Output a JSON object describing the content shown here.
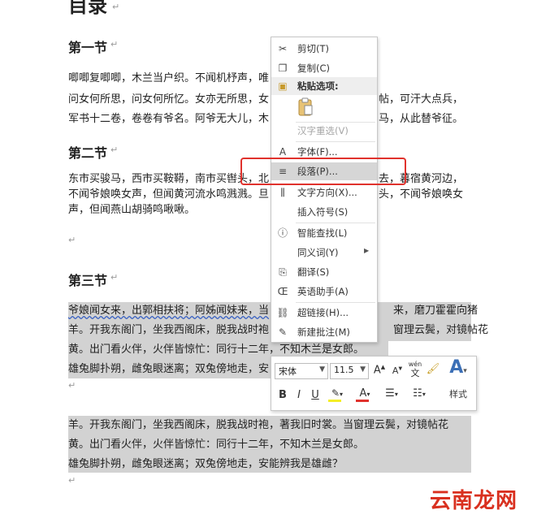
{
  "doc": {
    "title": "目录",
    "sections": [
      {
        "heading": "第一节",
        "lines": [
          "唧唧复唧唧，木兰当户织。不闻机杼声，唯",
          "问女何所思，问女何所忆。女亦无所思，女",
          "军书十二卷，卷卷有爷名。阿爷无大儿，木"
        ],
        "right": [
          "帖，可汗大点兵，",
          "马，从此替爷征。"
        ]
      },
      {
        "heading": "第二节",
        "lines": [
          "东市买骏马，西市买鞍鞯，南市买辔头，北",
          "不闻爷娘唤女声，但闻黄河流水鸣溅溅。旦",
          "声，但闻燕山胡骑鸣啾啾。"
        ],
        "right": [
          "去，暮宿黄河边，",
          "头，不闻爷娘唤女"
        ]
      },
      {
        "heading": "第三节",
        "lines": [
          "爷娘闻女来，出郭相扶将；阿姊闻妹来，当",
          "羊。开我东阁门，坐我西阁床，脱我战时袍",
          "黄。出门看火伴，火伴皆惊忙：同行十二年，不知木兰是女郎。",
          "雄兔脚扑朔，雌兔眼迷离；双兔傍地走，安"
        ],
        "right": [
          "来，磨刀霍霍向猪",
          "窗理云鬓，对镜帖花"
        ]
      },
      {
        "heading": "",
        "lines": [
          "羊。开我东阁门，坐我西阁床，脱我战时袍，著我旧时裳。当窗理云鬓，对镜帖花",
          "黄。出门看火伴，火伴皆惊忙：同行十二年，不知木兰是女郎。",
          "雄兔脚扑朔，雌兔眼迷离；双兔傍地走，安能辨我是雄雌？"
        ],
        "right": []
      }
    ]
  },
  "context_menu": {
    "items": [
      {
        "label": "剪切(T)",
        "icon": "scissors-icon",
        "glyph": "✂",
        "disabled": false
      },
      {
        "label": "复制(C)",
        "icon": "copy-icon",
        "glyph": "❐",
        "disabled": false
      },
      {
        "label": "粘贴选项:",
        "icon": "paste-icon",
        "glyph": "📋",
        "disabled": false
      },
      {
        "label": "汉字重选(V)",
        "icon": "",
        "glyph": "",
        "disabled": true
      },
      {
        "label": "字体(F)...",
        "icon": "font-icon",
        "glyph": "A",
        "disabled": false
      },
      {
        "label": "段落(P)...",
        "icon": "paragraph-icon",
        "glyph": "≡",
        "disabled": false
      },
      {
        "label": "文字方向(X)...",
        "icon": "text-direction-icon",
        "glyph": "⫼",
        "disabled": false
      },
      {
        "label": "插入符号(S)",
        "icon": "",
        "glyph": "",
        "disabled": false
      },
      {
        "label": "智能查找(L)",
        "icon": "smart-lookup-icon",
        "glyph": "ⓘ",
        "disabled": false
      },
      {
        "label": "同义词(Y)",
        "icon": "",
        "glyph": "",
        "disabled": false
      },
      {
        "label": "翻译(S)",
        "icon": "translate-icon",
        "glyph": "⎘",
        "disabled": false
      },
      {
        "label": "英语助手(A)",
        "icon": "english-assistant-icon",
        "glyph": "Œ",
        "disabled": false
      },
      {
        "label": "超链接(H)...",
        "icon": "hyperlink-icon",
        "glyph": "⛓",
        "disabled": false
      },
      {
        "label": "新建批注(M)",
        "icon": "new-comment-icon",
        "glyph": "✎",
        "disabled": false
      }
    ]
  },
  "toolbar": {
    "font_name": "宋体",
    "font_size": "11.5",
    "grow_font": "A",
    "shrink_font": "A",
    "phonetic": "wén",
    "phonetic_char": "文",
    "bold": "B",
    "italic": "I",
    "underline": "U",
    "font_color": "A",
    "styles_label": "样式"
  },
  "watermark": {
    "text": "云南龙网",
    "color": "#d9301f"
  }
}
